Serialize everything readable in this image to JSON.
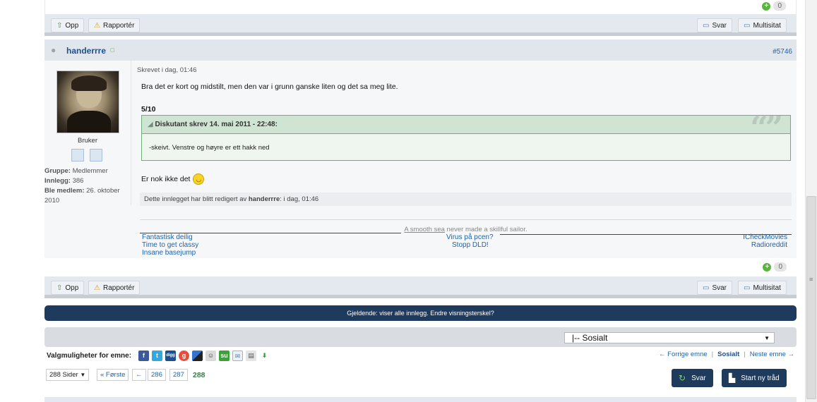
{
  "prev_post": {
    "rep_count": "0",
    "buttons": {
      "opp": "Opp",
      "rapporter": "Rapportér",
      "svar": "Svar",
      "multisitat": "Multisitat"
    }
  },
  "post": {
    "author": "handerrre",
    "post_number": "#5746",
    "posted": "Skrevet i dag, 01:46",
    "user": {
      "rank": "Bruker",
      "group_label": "Gruppe:",
      "group_value": "Medlemmer",
      "posts_label": "Innlegg:",
      "posts_value": "386",
      "joined_label": "Ble medlem:",
      "joined_value": "26. oktober 2010"
    },
    "text_1": "Bra det er kort og midstilt, men den var i grunn ganske liten og det sa meg lite.",
    "rating": "5/10",
    "quote": {
      "header": "Diskutant skrev 14. mai 2011 - 22:48:",
      "body": "-skeivt. Venstre og høyre er ett hakk ned"
    },
    "text_2": "Er nok ikke det",
    "edited_prefix": "Dette innlegget har blitt redigert av",
    "edited_by": "handerrre",
    "edited_suffix": ": i dag, 01:46",
    "signature": {
      "motto_1": "A smooth sea",
      "motto_2": " never made a skillful sailor.",
      "left_links": [
        "Fantastisk deilig",
        "Time to get classy",
        "Insane basejump"
      ],
      "center_links": [
        "Virus på pcen?",
        "Stopp DLD!"
      ],
      "right_links": [
        "ICheckMovies",
        "Radioreddit"
      ]
    },
    "rep_count": "0",
    "buttons": {
      "opp": "Opp",
      "rapporter": "Rapportér",
      "svar": "Svar",
      "multisitat": "Multisitat"
    }
  },
  "threshold_bar": "Gjeldende:  viser alle innlegg. Endre visningsterskel?",
  "forum_jump": {
    "selected": "|-- Sosialt"
  },
  "topic_options": {
    "label": "Valgmuligheter for emne:",
    "share_icons": [
      "facebook-icon",
      "twitter-icon",
      "digg-icon",
      "google-icon",
      "delicious-icon",
      "reddit-icon",
      "stumbleupon-icon",
      "email-icon",
      "print-icon",
      "download-icon"
    ]
  },
  "topic_nav": {
    "prev": "← Forrige emne",
    "current": "Sosialt",
    "next": "Neste emne →"
  },
  "pagination": {
    "pages_dropdown": "288 Sider",
    "first": "« Første",
    "prev": "←",
    "pages": [
      "286",
      "287"
    ],
    "current": "288"
  },
  "actions": {
    "reply": "Svar",
    "new_thread": "Start ny tråd"
  }
}
